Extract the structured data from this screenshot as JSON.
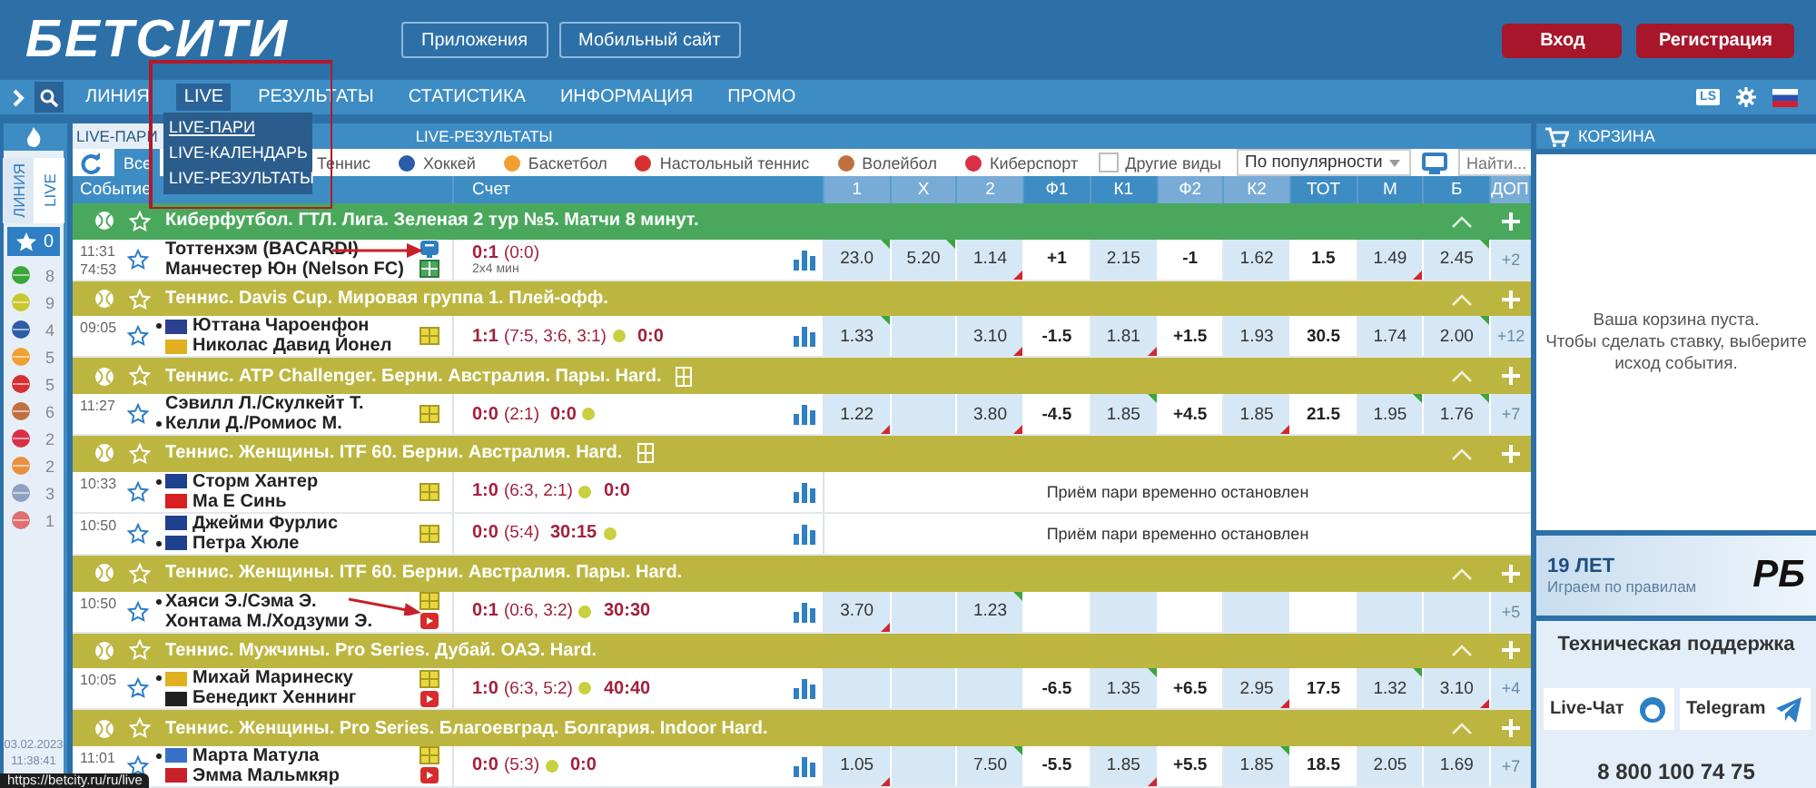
{
  "header": {
    "logo": "БЕТСИТИ",
    "links": [
      "Приложения",
      "Мобильный сайт"
    ],
    "auth": [
      "Вход",
      "Регистрация"
    ]
  },
  "nav": {
    "items": [
      {
        "label": "ЛИНИЯ",
        "selected": false
      },
      {
        "label": "LIVE",
        "selected": true
      },
      {
        "label": "РЕЗУЛЬТАТЫ",
        "selected": false
      },
      {
        "label": "СТАТИСТИКА",
        "selected": false
      },
      {
        "label": "ИНФОРМАЦИЯ",
        "selected": false
      },
      {
        "label": "ПРОМО",
        "selected": false
      }
    ],
    "ls_badge": "LS",
    "dropdown": [
      {
        "label": "LIVE-ПАРИ",
        "selected": true
      },
      {
        "label": "LIVE-КАЛЕНДАРЬ",
        "selected": false
      },
      {
        "label": "LIVE-РЕЗУЛЬТАТЫ",
        "selected": false
      }
    ]
  },
  "sidebar": {
    "tabs": [
      {
        "label": "ЛИНИЯ",
        "selected": false
      },
      {
        "label": "LIVE",
        "selected": true
      }
    ],
    "favorites": "0",
    "sports": [
      {
        "count": "8",
        "color": "#3aa63a"
      },
      {
        "count": "9",
        "color": "#c8c830"
      },
      {
        "count": "4",
        "color": "#2c5ca8"
      },
      {
        "count": "5",
        "color": "#f0a030"
      },
      {
        "count": "5",
        "color": "#d83030"
      },
      {
        "count": "6",
        "color": "#c07040"
      },
      {
        "count": "2",
        "color": "#d83048"
      },
      {
        "count": "2",
        "color": "#e89040"
      },
      {
        "count": "3",
        "color": "#8fa0c0"
      },
      {
        "count": "1",
        "color": "#e07070"
      }
    ],
    "datetime": [
      "03.02.2023",
      "11:38:41"
    ]
  },
  "main": {
    "tabs": [
      {
        "label": "LIVE-ПАРИ",
        "selected": true
      },
      {
        "label": "LIVE-РЕЗУЛЬТАТЫ",
        "selected": false
      }
    ],
    "filters": [
      {
        "label": "Все",
        "selected": true
      },
      {
        "label": "Теннис",
        "selected": false
      },
      {
        "label": "Хоккей",
        "selected": false,
        "color": "#2c5ca8"
      },
      {
        "label": "Баскетбол",
        "selected": false,
        "color": "#f0a030"
      },
      {
        "label": "Настольный теннис",
        "selected": false,
        "color": "#d83030"
      },
      {
        "label": "Волейбол",
        "selected": false,
        "color": "#c07040"
      },
      {
        "label": "Киберспорт",
        "selected": false,
        "color": "#d83048"
      }
    ],
    "other_sports": {
      "label": "Другие виды",
      "checked": false
    },
    "sort": "По популярности",
    "search": {
      "placeholder": "Найти..."
    },
    "columns": [
      "Событие",
      "Счет",
      "1",
      "X",
      "2",
      "Ф1",
      "К1",
      "Ф2",
      "К2",
      "ТОТ",
      "М",
      "Б",
      "ДОП"
    ],
    "rows": [
      {
        "kind": "league",
        "color": "#4aa85c",
        "title": "Киберфутбол. ГТЛ. Лига. Зеленая 2 тур №5. Матчи 8 минут."
      },
      {
        "kind": "event",
        "time": "11:31",
        "clock": "74:53",
        "teams": [
          {
            "name": "Тоттенхэм (BACARDI)"
          },
          {
            "name": "Манчестер Юн (Nelson FC)"
          }
        ],
        "media": [
          {
            "kind": "tv"
          },
          {
            "kind": "field"
          }
        ],
        "score": {
          "main": "0:1",
          "sets": "(0:0)"
        },
        "sub": "2x4 мин",
        "odds": {
          "p1": {
            "value": "23.0",
            "rise": true
          },
          "px": {
            "value": "5.20",
            "rise": true
          },
          "p2": {
            "value": "1.14",
            "fall": true
          },
          "h1": {
            "value": "+1"
          },
          "k1": {
            "value": "2.15"
          },
          "h2": {
            "value": "-1"
          },
          "k2": {
            "value": "1.62"
          },
          "total": {
            "value": "1.5"
          },
          "under": {
            "value": "1.49",
            "fall": true
          },
          "over": {
            "value": "2.45",
            "rise": true
          }
        },
        "extra": "+2"
      },
      {
        "kind": "league",
        "color": "#bcb641",
        "title": "Теннис. Davis Cup. Мировая группа 1. Плей-офф."
      },
      {
        "kind": "event",
        "time": "09:05",
        "teams": [
          {
            "name": "Юттана Чароенфон",
            "server": true,
            "color": "#2d3f8f"
          },
          {
            "name": "Николас Давид Йонел",
            "color": "#e0b020"
          }
        ],
        "media": [
          {
            "kind": "scoreboard"
          }
        ],
        "score": {
          "main": "1:1",
          "sets": "(7:5, 3:6, 3:1)",
          "serve_ball": true,
          "game": "0:0"
        },
        "odds": {
          "p1": {
            "value": "1.33",
            "rise": true
          },
          "p2": {
            "value": "3.10",
            "fall": true
          },
          "h1": {
            "value": "-1.5"
          },
          "k1": {
            "value": "1.81",
            "fall": true
          },
          "h2": {
            "value": "+1.5"
          },
          "k2": {
            "value": "1.93"
          },
          "total": {
            "value": "30.5"
          },
          "under": {
            "value": "1.74"
          },
          "over": {
            "value": "2.00",
            "rise": true
          }
        },
        "extra": "+12"
      },
      {
        "kind": "league",
        "color": "#bcb641",
        "title": "Теннис. ATP Challenger. Берни. Австралия. Пары. Hard.",
        "court_icon": true
      },
      {
        "kind": "event",
        "time": "11:27",
        "teams": [
          {
            "name": "Сэвилл Л./Скулкейт Т."
          },
          {
            "name": "Келли Д./Ромиос М.",
            "server": true
          }
        ],
        "media": [
          {
            "kind": "scoreboard"
          }
        ],
        "score": {
          "main": "0:0",
          "sets": "(2:1)",
          "game": "0:0",
          "serve_ball": true,
          "ball_after_game": true
        },
        "odds": {
          "p1": {
            "value": "1.22",
            "fall": true
          },
          "p2": {
            "value": "3.80",
            "fall": true
          },
          "h1": {
            "value": "-4.5"
          },
          "k1": {
            "value": "1.85",
            "rise": true
          },
          "h2": {
            "value": "+4.5"
          },
          "k2": {
            "value": "1.85",
            "fall": true
          },
          "total": {
            "value": "21.5"
          },
          "under": {
            "value": "1.95",
            "rise": true
          },
          "over": {
            "value": "1.76",
            "rise": true
          }
        },
        "extra": "+7"
      },
      {
        "kind": "league",
        "color": "#bcb641",
        "title": "Теннис. Женщины. ITF 60. Берни. Австралия. Hard.",
        "court_icon": true
      },
      {
        "kind": "event",
        "time": "10:33",
        "teams": [
          {
            "name": "Сторм Хантер",
            "server": true,
            "color": "#1f3f8f"
          },
          {
            "name": "Ма Е Синь",
            "color": "#d82020"
          }
        ],
        "media": [
          {
            "kind": "scoreboard"
          }
        ],
        "score": {
          "main": "1:0",
          "sets": "(6:3, 2:1)",
          "serve_ball": true,
          "game": "0:0"
        },
        "suspended": "Приём пари временно остановлен"
      },
      {
        "kind": "event",
        "time": "10:50",
        "teams": [
          {
            "name": "Джейми Фурлис",
            "color": "#1f3f8f"
          },
          {
            "name": "Петра Хюле",
            "server": true,
            "color": "#1f3f8f"
          }
        ],
        "media": [
          {
            "kind": "scoreboard"
          }
        ],
        "score": {
          "main": "0:0",
          "sets": "(5:4)",
          "game": "30:15",
          "serve_ball": true,
          "ball_after_game": true
        },
        "suspended": "Приём пари временно остановлен"
      },
      {
        "kind": "league",
        "color": "#bcb641",
        "title": "Теннис. Женщины. ITF 60. Берни. Австралия. Пары. Hard."
      },
      {
        "kind": "event",
        "time": "10:50",
        "teams": [
          {
            "name": "Хаяси Э./Сэма Э.",
            "server": true
          },
          {
            "name": "Хонтама М./Ходзуми Э."
          }
        ],
        "media": [
          {
            "kind": "scoreboard"
          },
          {
            "kind": "video"
          }
        ],
        "score": {
          "main": "0:1",
          "sets": "(0:6, 3:2)",
          "serve_ball": true,
          "game": "30:30"
        },
        "odds": {
          "p1": {
            "value": "3.70",
            "fall": true
          },
          "p2": {
            "value": "1.23",
            "rise": true
          }
        },
        "extra": "+5"
      },
      {
        "kind": "league",
        "color": "#bcb641",
        "title": "Теннис. Мужчины. Pro Series. Дубай. ОАЭ. Hard."
      },
      {
        "kind": "event",
        "time": "10:05",
        "teams": [
          {
            "name": "Михай Маринеску",
            "server": true,
            "color": "#e0b020"
          },
          {
            "name": "Бенедикт Хеннинг",
            "color": "#202020"
          }
        ],
        "media": [
          {
            "kind": "scoreboard"
          },
          {
            "kind": "video"
          }
        ],
        "score": {
          "main": "1:0",
          "sets": "(6:3, 5:2)",
          "serve_ball": true,
          "game": "40:40"
        },
        "odds": {
          "h1": {
            "value": "-6.5"
          },
          "k1": {
            "value": "1.35",
            "rise": true
          },
          "h2": {
            "value": "+6.5"
          },
          "k2": {
            "value": "2.95",
            "fall": true
          },
          "total": {
            "value": "17.5"
          },
          "under": {
            "value": "1.32",
            "rise": true
          },
          "over": {
            "value": "3.10",
            "fall": true
          }
        },
        "extra": "+4"
      },
      {
        "kind": "league",
        "color": "#bcb641",
        "title": "Теннис. Женщины. Pro Series. Благоевград. Болгария. Indoor Hard."
      },
      {
        "kind": "event",
        "time": "11:01",
        "teams": [
          {
            "name": "Марта Матула",
            "server": true,
            "color": "#3a70c8"
          },
          {
            "name": "Эмма Мальмкяр",
            "color": "#c8202a"
          }
        ],
        "media": [
          {
            "kind": "scoreboard"
          },
          {
            "kind": "video"
          }
        ],
        "score": {
          "main": "0:0",
          "sets": "(5:3)",
          "serve_ball": true,
          "game": "0:0"
        },
        "odds": {
          "p1": {
            "value": "1.05",
            "fall": true
          },
          "p2": {
            "value": "7.50",
            "rise": true
          },
          "h1": {
            "value": "-5.5"
          },
          "k1": {
            "value": "1.85",
            "fall": true
          },
          "h2": {
            "value": "+5.5"
          },
          "k2": {
            "value": "1.85",
            "rise": true
          },
          "total": {
            "value": "18.5"
          },
          "under": {
            "value": "2.05"
          },
          "over": {
            "value": "1.69"
          }
        },
        "extra": "+7"
      }
    ]
  },
  "cart": {
    "title": "КОРЗИНА",
    "empty_message": [
      "Ваша корзина пуста.",
      "Чтобы сделать ставку, выберите исход события."
    ]
  },
  "promo": {
    "title": "19 ЛЕТ",
    "subtitle": "Играем по правилам",
    "logo": "РБ"
  },
  "support": {
    "title": "Техническая поддержка",
    "buttons": [
      {
        "label": "Live-Чат",
        "kind": "chat"
      },
      {
        "label": "Telegram",
        "kind": "telegram"
      }
    ],
    "phone": "8 800 100 74 75"
  },
  "status_url": "https://betcity.ru/ru/live"
}
